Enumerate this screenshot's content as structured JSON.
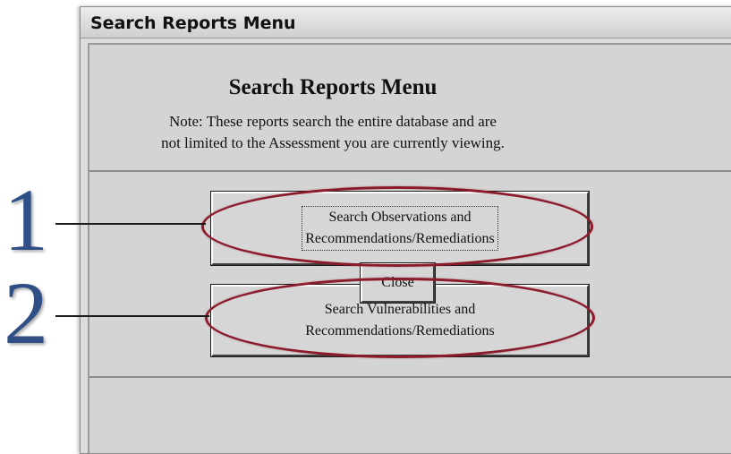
{
  "window": {
    "title": "Search Reports Menu"
  },
  "dialog": {
    "heading": "Search Reports Menu",
    "note_line1": "Note: These reports search the entire database and are",
    "note_line2": "not limited to the Assessment you are currently viewing."
  },
  "buttons": {
    "observations_line1": "Search Observations and",
    "observations_line2": "Recommendations/Remediations",
    "vulnerabilities_line1": "Search Vulnerabilities and",
    "vulnerabilities_line2": "Recommendations/Remediations",
    "close_label": "Close"
  },
  "annotations": {
    "callout_1": "1",
    "callout_2": "2"
  },
  "colors": {
    "highlight": "#8b1a2b",
    "callout_number": "#2f4f86"
  }
}
